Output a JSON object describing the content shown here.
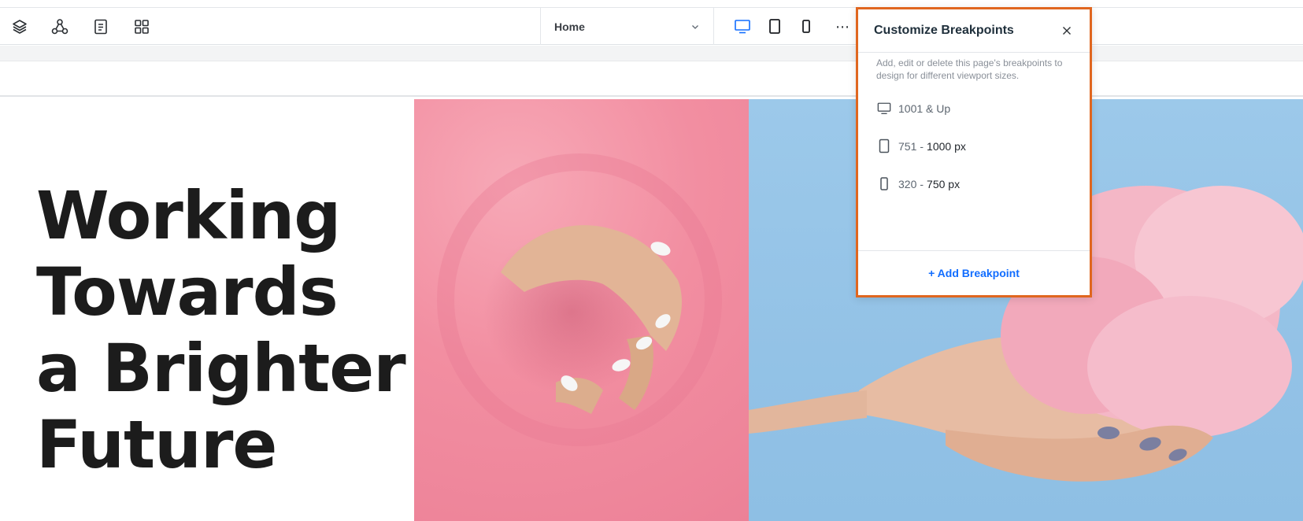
{
  "toolbar": {
    "tools": [
      {
        "icon": "layers-icon"
      },
      {
        "icon": "connect-nodes-icon"
      },
      {
        "icon": "page-icon"
      },
      {
        "icon": "apps-grid-icon"
      }
    ],
    "page_selector": {
      "value": "Home",
      "icon": "chevron-down-icon"
    },
    "breakpoints": [
      {
        "icon": "desktop-icon",
        "active": true
      },
      {
        "icon": "tablet-icon",
        "active": false
      },
      {
        "icon": "mobile-icon",
        "active": false
      }
    ],
    "more_label": "⋯",
    "accent_color": "#116dff"
  },
  "hero": {
    "lines": [
      "Working",
      "Towards",
      "a Brighter",
      "Future"
    ]
  },
  "breakpoints_panel": {
    "title": "Customize Breakpoints",
    "description": "Add, edit or delete this page's breakpoints to design for different viewport sizes.",
    "items": [
      {
        "icon": "desktop-icon",
        "label": "1001 & Up",
        "separator": "",
        "end": ""
      },
      {
        "icon": "tablet-icon",
        "label": "751",
        "separator": "-",
        "end": "1000 px"
      },
      {
        "icon": "mobile-icon",
        "label": "320",
        "separator": "-",
        "end": "750 px"
      }
    ],
    "add_label": "+ Add Breakpoint",
    "border_color": "#e0661f"
  }
}
